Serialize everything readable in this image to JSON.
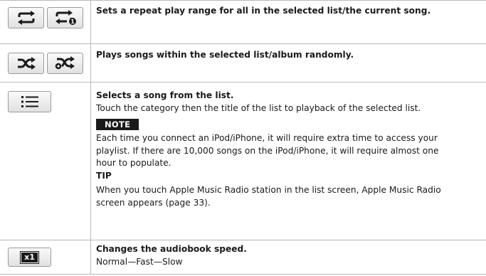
{
  "rows": [
    {
      "icons": [
        "repeat-all-icon",
        "repeat-one-icon"
      ],
      "title": "Sets a repeat play range for all in the selected list/the current song."
    },
    {
      "icons": [
        "shuffle-songs-icon",
        "shuffle-albums-icon"
      ],
      "title": "Plays songs within the selected list/album randomly."
    },
    {
      "icons": [
        "list-icon"
      ],
      "title": "Selects a song from the list.",
      "body": "Touch the category then the title of the list to playback of the selected list.",
      "note_label": "NOTE",
      "note_text": "Each time you connect an iPod/iPhone, it will require extra time to access your playlist. If there are 10,000 songs on the iPod/iPhone, it will require almost one hour to populate.",
      "tip_label": "TIP",
      "tip_text": "When you touch Apple Music Radio station in the list screen, Apple Music Radio screen appears (page 33)."
    },
    {
      "icons": [
        "speed-x1-icon"
      ],
      "icon_text": "x1",
      "title": "Changes the audiobook speed.",
      "body": "Normal—Fast—Slow"
    }
  ]
}
